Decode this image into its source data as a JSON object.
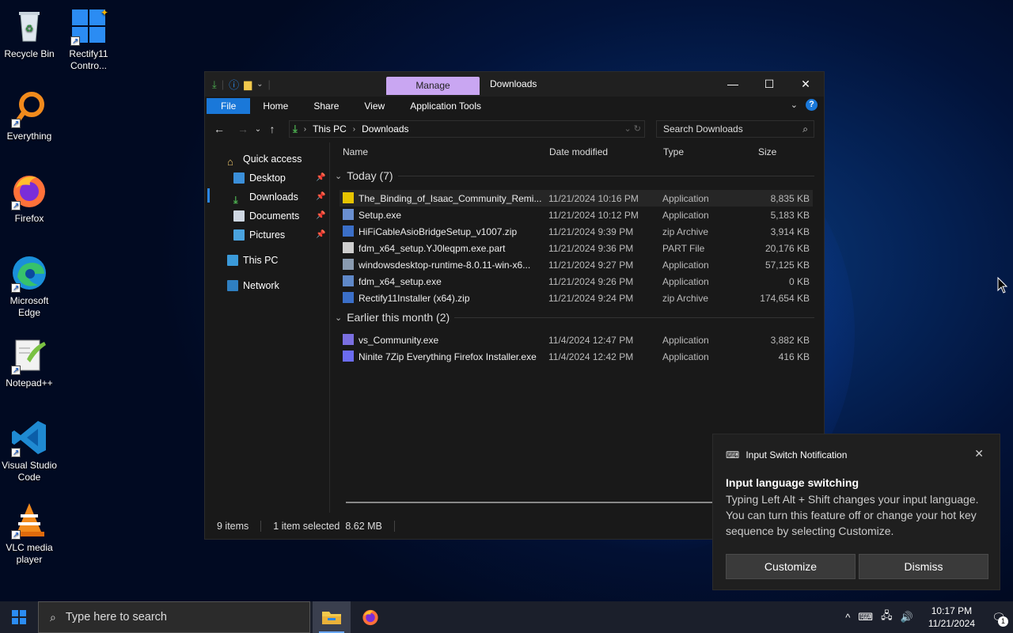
{
  "desktop": {
    "icons": [
      {
        "label": "Recycle Bin",
        "icon": "recycle-bin-icon"
      },
      {
        "label": "Rectify11 Contro...",
        "icon": "rectify11-control-icon"
      },
      {
        "label": "Everything",
        "icon": "everything-search-icon"
      },
      {
        "label": "Firefox",
        "icon": "firefox-icon"
      },
      {
        "label": "Microsoft Edge",
        "icon": "edge-icon"
      },
      {
        "label": "Notepad++",
        "icon": "notepadpp-icon"
      },
      {
        "label": "Visual Studio Code",
        "icon": "vscode-icon"
      },
      {
        "label": "VLC media player",
        "icon": "vlc-icon"
      }
    ]
  },
  "explorer": {
    "manage_tab": "Manage",
    "title": "Downloads",
    "ribbon": {
      "file": "File",
      "home": "Home",
      "share": "Share",
      "view": "View",
      "app_tools": "Application Tools"
    },
    "address": {
      "this_pc": "This PC",
      "downloads": "Downloads"
    },
    "search_placeholder": "Search Downloads",
    "nav": {
      "quick_access": "Quick access",
      "desktop": "Desktop",
      "downloads": "Downloads",
      "documents": "Documents",
      "pictures": "Pictures",
      "this_pc": "This PC",
      "network": "Network"
    },
    "columns": {
      "name": "Name",
      "date": "Date modified",
      "type": "Type",
      "size": "Size"
    },
    "groups": {
      "today": "Today (7)",
      "earlier": "Earlier this month (2)"
    },
    "files_today": [
      {
        "name": "The_Binding_of_Isaac_Community_Remi...",
        "date": "11/21/2024 10:16 PM",
        "type": "Application",
        "size": "8,835 KB"
      },
      {
        "name": "Setup.exe",
        "date": "11/21/2024 10:12 PM",
        "type": "Application",
        "size": "5,183 KB"
      },
      {
        "name": "HiFiCableAsioBridgeSetup_v1007.zip",
        "date": "11/21/2024 9:39 PM",
        "type": "zip Archive",
        "size": "3,914 KB"
      },
      {
        "name": "fdm_x64_setup.YJ0leqpm.exe.part",
        "date": "11/21/2024 9:36 PM",
        "type": "PART File",
        "size": "20,176 KB"
      },
      {
        "name": "windowsdesktop-runtime-8.0.11-win-x6...",
        "date": "11/21/2024 9:27 PM",
        "type": "Application",
        "size": "57,125 KB"
      },
      {
        "name": "fdm_x64_setup.exe",
        "date": "11/21/2024 9:26 PM",
        "type": "Application",
        "size": "0 KB"
      },
      {
        "name": "Rectify11Installer (x64).zip",
        "date": "11/21/2024 9:24 PM",
        "type": "zip Archive",
        "size": "174,654 KB"
      }
    ],
    "files_earlier": [
      {
        "name": "vs_Community.exe",
        "date": "11/4/2024 12:47 PM",
        "type": "Application",
        "size": "3,882 KB"
      },
      {
        "name": "Ninite 7Zip Everything Firefox Installer.exe",
        "date": "11/4/2024 12:42 PM",
        "type": "Application",
        "size": "416 KB"
      }
    ],
    "status": {
      "items": "9 items",
      "selected": "1 item selected  8.62 MB"
    }
  },
  "toast": {
    "app": "Input Switch Notification",
    "title": "Input language switching",
    "body": "Typing Left Alt + Shift changes your input language. You can turn this feature off or change your hot key sequence by selecting Customize.",
    "customize": "Customize",
    "dismiss": "Dismiss"
  },
  "taskbar": {
    "search_placeholder": "Type here to search",
    "time": "10:17 PM",
    "date": "11/21/2024",
    "notification_count": "1"
  }
}
